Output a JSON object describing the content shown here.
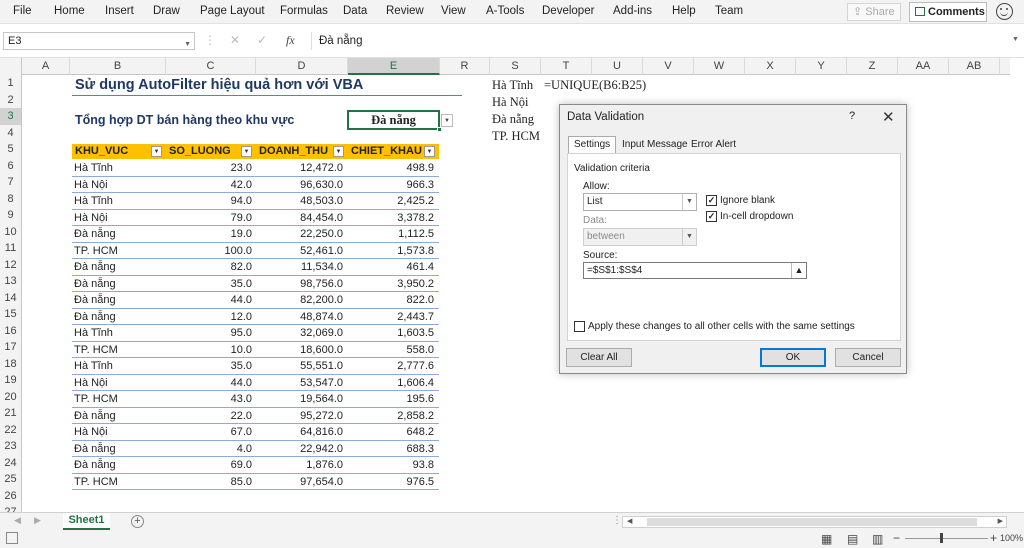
{
  "ribbon": {
    "tabs": [
      "File",
      "Home",
      "Insert",
      "Draw",
      "Page Layout",
      "Formulas",
      "Data",
      "Review",
      "View",
      "A-Tools",
      "Developer",
      "Add-ins",
      "Help",
      "Team"
    ],
    "share_label": "Share",
    "comments_label": "Comments"
  },
  "formula_bar": {
    "name_box": "E3",
    "formula": "Đà nẵng"
  },
  "columns": [
    "A",
    "B",
    "C",
    "D",
    "E",
    "R",
    "S",
    "T",
    "U",
    "V",
    "W",
    "X",
    "Y",
    "Z",
    "AA",
    "AB"
  ],
  "rows": [
    "1",
    "2",
    "3",
    "4",
    "5",
    "6",
    "7",
    "8",
    "9",
    "10",
    "11",
    "12",
    "13",
    "14",
    "15",
    "16",
    "17",
    "18",
    "19",
    "20",
    "21",
    "22",
    "23",
    "24",
    "25",
    "26",
    "27"
  ],
  "sheet": {
    "title": "Sử dụng AutoFilter hiệu quả hơn với VBA",
    "subtitle": "Tổng hợp DT bán hàng theo khu vực",
    "e3_value": "Đà nẵng",
    "table": {
      "headers": [
        "KHU_VUC",
        "SO_LUONG",
        "DOANH_THU",
        "CHIET_KHAU"
      ],
      "rows": [
        [
          "Hà Tĩnh",
          "23.0",
          "12,472.0",
          "498.9"
        ],
        [
          "Hà Nội",
          "42.0",
          "96,630.0",
          "966.3"
        ],
        [
          "Hà Tĩnh",
          "94.0",
          "48,503.0",
          "2,425.2"
        ],
        [
          "Hà Nội",
          "79.0",
          "84,454.0",
          "3,378.2"
        ],
        [
          "Đà nẵng",
          "19.0",
          "22,250.0",
          "1,112.5"
        ],
        [
          "TP. HCM",
          "100.0",
          "52,461.0",
          "1,573.8"
        ],
        [
          "Đà nẵng",
          "82.0",
          "11,534.0",
          "461.4"
        ],
        [
          "Đà nẵng",
          "35.0",
          "98,756.0",
          "3,950.2"
        ],
        [
          "Đà nẵng",
          "44.0",
          "82,200.0",
          "822.0"
        ],
        [
          "Đà nẵng",
          "12.0",
          "48,874.0",
          "2,443.7"
        ],
        [
          "Hà Tĩnh",
          "95.0",
          "32,069.0",
          "1,603.5"
        ],
        [
          "TP. HCM",
          "10.0",
          "18,600.0",
          "558.0"
        ],
        [
          "Hà Tĩnh",
          "35.0",
          "55,551.0",
          "2,777.6"
        ],
        [
          "Hà Nội",
          "44.0",
          "53,547.0",
          "1,606.4"
        ],
        [
          "TP. HCM",
          "43.0",
          "19,564.0",
          "195.6"
        ],
        [
          "Đà nẵng",
          "22.0",
          "95,272.0",
          "2,858.2"
        ],
        [
          "Hà Nội",
          "67.0",
          "64,816.0",
          "648.2"
        ],
        [
          "Đà nẵng",
          "4.0",
          "22,942.0",
          "688.3"
        ],
        [
          "Đà nẵng",
          "69.0",
          "1,876.0",
          "93.8"
        ],
        [
          "TP. HCM",
          "85.0",
          "97,654.0",
          "976.5"
        ]
      ]
    },
    "unique_values": [
      "Hà Tĩnh",
      "Hà Nội",
      "Đà nẵng",
      "TP. HCM"
    ],
    "unique_formula": "=UNIQUE(B6:B25)"
  },
  "dialog": {
    "title": "Data Validation",
    "help": "?",
    "tabs": [
      "Settings",
      "Input Message",
      "Error Alert"
    ],
    "criteria_label": "Validation criteria",
    "allow_label": "Allow:",
    "allow_value": "List",
    "data_label": "Data:",
    "data_value": "between",
    "ignore_blank_label": "Ignore blank",
    "ignore_blank_checked": true,
    "incell_dropdown_label": "In-cell dropdown",
    "incell_dropdown_checked": true,
    "source_label": "Source:",
    "source_value": "=$S$1:$S$4",
    "apply_all_label": "Apply these changes to all other cells with the same settings",
    "apply_all_checked": false,
    "clear_all_label": "Clear All",
    "ok_label": "OK",
    "cancel_label": "Cancel"
  },
  "sheet_tabs": [
    "Sheet1"
  ],
  "status": {
    "zoom": "100%"
  },
  "colors": {
    "accent": "#217346",
    "table_header": "#ffc000",
    "title": "#1f3864"
  }
}
